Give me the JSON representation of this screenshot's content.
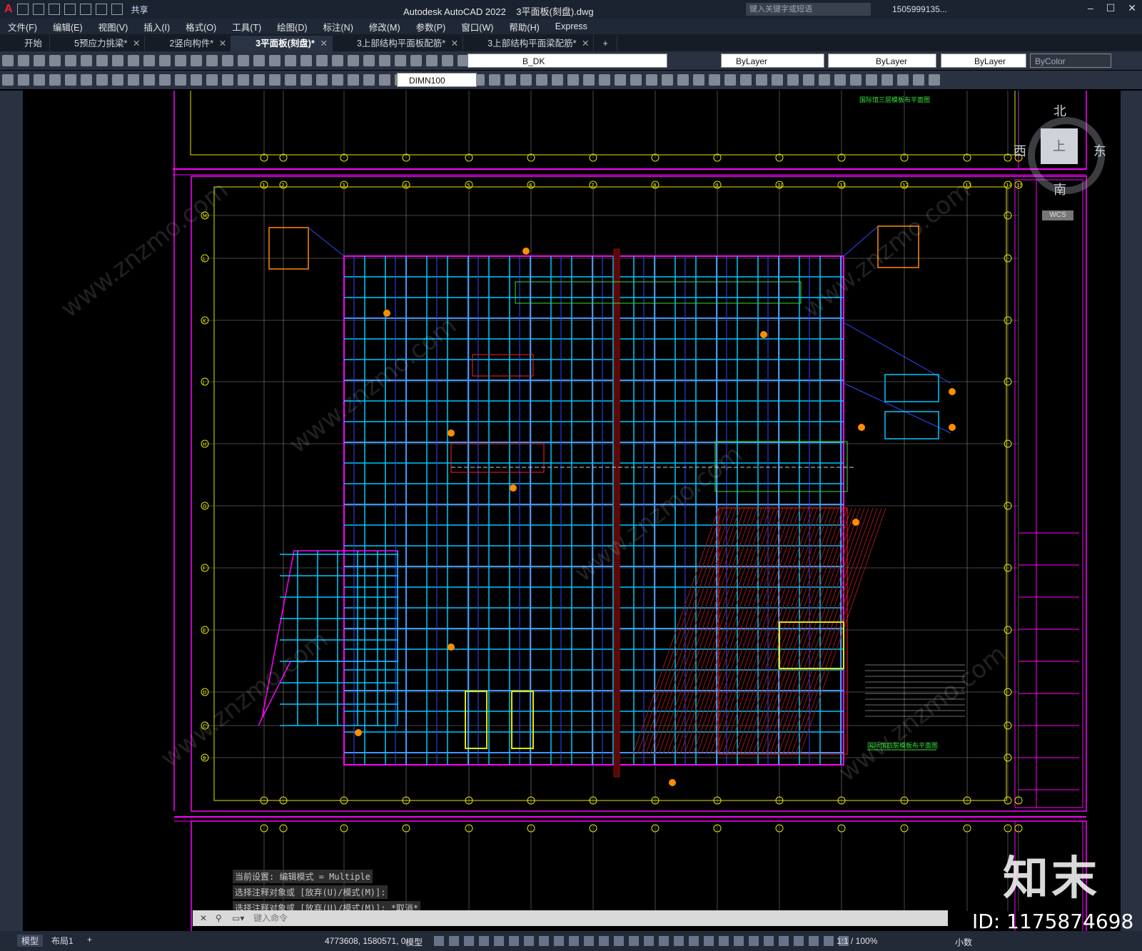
{
  "titlebar": {
    "share": "共享",
    "app_title": "Autodesk AutoCAD 2022",
    "file_name": "3平面板(刻盘).dwg",
    "search_placeholder": "键入关键字或短语",
    "user": "1505999135..."
  },
  "menu": [
    "文件(F)",
    "编辑(E)",
    "视图(V)",
    "插入(I)",
    "格式(O)",
    "工具(T)",
    "绘图(D)",
    "标注(N)",
    "修改(M)",
    "参数(P)",
    "窗口(W)",
    "帮助(H)",
    "Express"
  ],
  "tabs": [
    {
      "label": "开始",
      "active": false,
      "closable": false
    },
    {
      "label": "5预应力挑梁*",
      "active": false,
      "closable": true
    },
    {
      "label": "2竖向构件*",
      "active": false,
      "closable": true
    },
    {
      "label": "3平面板(刻盘)*",
      "active": true,
      "closable": true
    },
    {
      "label": "3上部结构平面板配筋*",
      "active": false,
      "closable": true
    },
    {
      "label": "3上部结构平面梁配筋*",
      "active": false,
      "closable": true
    }
  ],
  "properties": {
    "layer": "B_DK",
    "color": "ByLayer",
    "linetype": "ByLayer",
    "lineweight": "ByLayer",
    "plotstyle": "ByColor",
    "dimstyle": "DIMN100"
  },
  "viewcube": {
    "north": "北",
    "south": "南",
    "west": "西",
    "east": "东",
    "top": "上",
    "wcs": "WCS"
  },
  "drawing": {
    "title1": "国际馆三层模板布平面图",
    "title2": "国际馆四层模板布平面图",
    "grid_cols": [
      "1",
      "2",
      "3",
      "4",
      "5",
      "6",
      "7",
      "8",
      "9",
      "10",
      "11",
      "12",
      "13",
      "14",
      "15"
    ],
    "grid_rows": [
      "M",
      "L",
      "K",
      "J",
      "H",
      "G",
      "F",
      "E",
      "D",
      "C",
      "B"
    ]
  },
  "command": {
    "history": [
      "当前设置: 编辑模式 = Multiple",
      "选择注释对象或 [放弃(U)/模式(M)]:",
      "选择注释对象或 [放弃(U)/模式(M)]: *取消*"
    ],
    "placeholder": "键入命令"
  },
  "status": {
    "model_tab": "模型",
    "layout_tab": "布局1",
    "coords": "4773608, 1580571, 0",
    "space": "模型",
    "scale": "1:1 / 100%",
    "units": "小数"
  },
  "watermark": {
    "logo": "知末",
    "id": "ID: 1175874698",
    "url": "www.znzmo.com"
  },
  "colors": {
    "magenta": "#ff00ff",
    "cyan": "#00c8ff",
    "blue": "#2a4bff",
    "yellow": "#e5e500",
    "green": "#35e03a",
    "red": "#ff2020",
    "grey": "#9a9a9a",
    "orange": "#ff8c00"
  }
}
